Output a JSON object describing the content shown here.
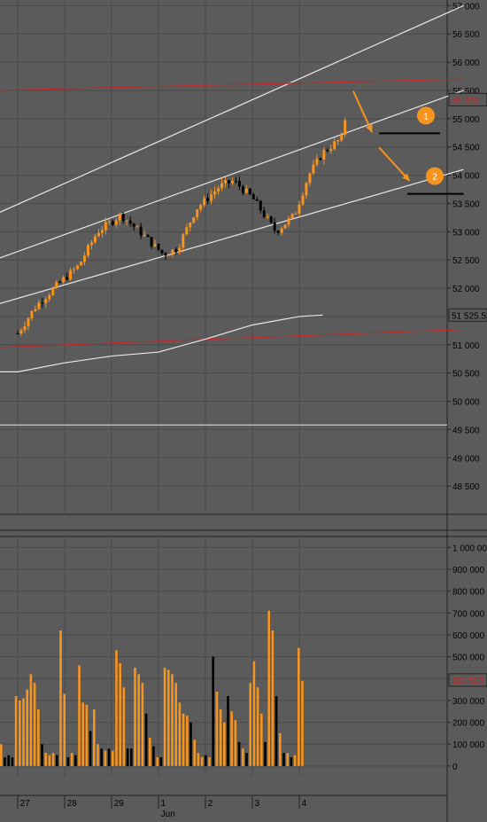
{
  "chart_data": [
    {
      "type": "candlestick",
      "title": "",
      "ylim": [
        48000,
        57100
      ],
      "y_ticks": [
        {
          "label": "57 000",
          "value": 57000
        },
        {
          "label": "56 500",
          "value": 56500
        },
        {
          "label": "56 000",
          "value": 56000
        },
        {
          "label": "55 500",
          "value": 55500
        },
        {
          "label": "55 000",
          "value": 55000
        },
        {
          "label": "54 500",
          "value": 54500
        },
        {
          "label": "54 000",
          "value": 54000
        },
        {
          "label": "53 500",
          "value": 53500
        },
        {
          "label": "53 000",
          "value": 53000
        },
        {
          "label": "52 500",
          "value": 52500
        },
        {
          "label": "52 000",
          "value": 52000
        },
        {
          "label": "51 500",
          "value": 51500
        },
        {
          "label": "51 000",
          "value": 51000
        },
        {
          "label": "50 500",
          "value": 50500
        },
        {
          "label": "50 000",
          "value": 50000
        },
        {
          "label": "49 500",
          "value": 49500
        },
        {
          "label": "49 000",
          "value": 49000
        },
        {
          "label": "48 500",
          "value": 48500
        }
      ],
      "last_price_label": "55 338",
      "last_price": 55338,
      "ma_label": "51 525.5",
      "ma_value": 51525.5,
      "horizontal_line": 49580,
      "annotation_markers": [
        {
          "label": "1",
          "value": 54740
        },
        {
          "label": "2",
          "value": 53670
        }
      ],
      "price_path": [
        [
          0,
          51200
        ],
        [
          0.4,
          51700
        ],
        [
          0.9,
          52100
        ],
        [
          1.3,
          52400
        ],
        [
          1.7,
          53000
        ],
        [
          2.2,
          53300
        ],
        [
          2.6,
          53000
        ],
        [
          3.1,
          52600
        ],
        [
          3.4,
          52700
        ],
        [
          3.8,
          53400
        ],
        [
          4.3,
          53800
        ],
        [
          4.6,
          53900
        ],
        [
          5.0,
          53600
        ],
        [
          5.5,
          53000
        ],
        [
          5.9,
          53300
        ],
        [
          6.2,
          54000
        ],
        [
          6.5,
          54400
        ],
        [
          6.9,
          54650
        ],
        [
          7.05,
          55338
        ]
      ],
      "moving_average": [
        [
          -0.5,
          50520
        ],
        [
          0,
          50520
        ],
        [
          1,
          50680
        ],
        [
          2,
          50800
        ],
        [
          3,
          50870
        ],
        [
          4,
          51100
        ],
        [
          5,
          51350
        ],
        [
          6,
          51500
        ],
        [
          6.5,
          51525.5
        ]
      ],
      "channel_lines": [
        {
          "from": [
            -0.5,
            53300
          ],
          "to": [
            9.5,
            57000
          ]
        },
        {
          "from": [
            -0.5,
            52500
          ],
          "to": [
            9.5,
            55500
          ]
        },
        {
          "from": [
            -0.5,
            51700
          ],
          "to": [
            9.5,
            54100
          ]
        }
      ],
      "red_lines": [
        {
          "from": [
            -0.5,
            55500
          ],
          "to": [
            9.5,
            55700
          ]
        },
        {
          "from": [
            -0.5,
            50950
          ],
          "to": [
            9.5,
            51270
          ]
        }
      ],
      "target_levels": [
        {
          "from": [
            7.7,
            54740
          ],
          "to": [
            9.0,
            54740
          ]
        },
        {
          "from": [
            8.3,
            53670
          ],
          "to": [
            9.5,
            53670
          ]
        }
      ],
      "arrows": [
        {
          "from": [
            7.15,
            55490
          ],
          "to": [
            7.55,
            54760
          ]
        },
        {
          "from": [
            7.7,
            54490
          ],
          "to": [
            8.35,
            53900
          ]
        }
      ]
    },
    {
      "type": "bar",
      "title": "",
      "ylim": [
        -45000,
        1050000
      ],
      "y_ticks": [
        {
          "label": "1 000 000",
          "value": 1000000
        },
        {
          "label": "900 000",
          "value": 900000
        },
        {
          "label": "800 000",
          "value": 800000
        },
        {
          "label": "700 000",
          "value": 700000
        },
        {
          "label": "600 000",
          "value": 600000
        },
        {
          "label": "500 000",
          "value": 500000
        },
        {
          "label": "400 000",
          "value": 400000
        },
        {
          "label": "300 000",
          "value": 300000
        },
        {
          "label": "200 000",
          "value": 200000
        },
        {
          "label": "100 000",
          "value": 100000
        },
        {
          "label": "0",
          "value": 0
        }
      ],
      "last_volume_label": "393 593",
      "last_volume": 393593,
      "series": [
        {
          "values": [
            100000,
            40000,
            50000,
            40000,
            320000,
            300000,
            310000,
            350000,
            420000,
            380000,
            260000,
            100000,
            60000,
            50000,
            60000,
            50000,
            620000,
            330000,
            40000,
            60000,
            50000,
            460000,
            290000,
            280000,
            160000,
            260000,
            100000,
            80000,
            70000,
            80000,
            70000,
            530000,
            470000,
            360000,
            80000,
            80000,
            450000,
            420000,
            380000,
            240000,
            130000,
            90000,
            40000,
            40000,
            450000,
            440000,
            420000,
            380000,
            290000,
            240000,
            230000,
            200000,
            120000,
            60000,
            40000,
            50000,
            40000,
            500000,
            340000,
            260000,
            200000,
            320000,
            250000,
            210000,
            110000,
            80000,
            60000,
            380000,
            480000,
            360000,
            240000,
            110000,
            710000,
            620000,
            320000,
            150000,
            60000,
            60000,
            40000,
            50000,
            540000,
            390000
          ],
          "colors": [
            "o",
            "k",
            "k",
            "k",
            "o",
            "o",
            "o",
            "o",
            "o",
            "o",
            "o",
            "k",
            "o",
            "o",
            "o",
            "k",
            "o",
            "o",
            "k",
            "o",
            "k",
            "o",
            "o",
            "o",
            "k",
            "o",
            "o",
            "k",
            "o",
            "k",
            "o",
            "o",
            "o",
            "o",
            "k",
            "k",
            "o",
            "o",
            "o",
            "k",
            "o",
            "k",
            "o",
            "k",
            "o",
            "o",
            "o",
            "o",
            "o",
            "o",
            "o",
            "k",
            "o",
            "o",
            "o",
            "k",
            "o",
            "k",
            "o",
            "o",
            "o",
            "k",
            "o",
            "o",
            "k",
            "o",
            "k",
            "o",
            "o",
            "o",
            "o",
            "k",
            "o",
            "o",
            "k",
            "o",
            "k",
            "o",
            "k",
            "o",
            "o",
            "o"
          ]
        }
      ]
    }
  ],
  "x_labels": [
    {
      "label": "27",
      "pos": 0.05
    },
    {
      "label": "28",
      "pos": 1.05
    },
    {
      "label": "29",
      "pos": 2.05
    },
    {
      "label": "1",
      "pos": 3.05
    },
    {
      "label": "2",
      "pos": 4.05
    },
    {
      "label": "3",
      "pos": 5.05
    },
    {
      "label": "4",
      "pos": 6.05
    }
  ],
  "x_sublabel": {
    "label": "Jun",
    "pos": 3.05
  },
  "colors": {
    "background": "#5b5b5b",
    "orange": "#f7941d",
    "black": "#000000",
    "white_lines": "#e8e8e8",
    "red_lines": "#c0282a",
    "last_price_text": "#c0282a",
    "grid": "#4a4a4a",
    "marker": "#f7941d"
  }
}
